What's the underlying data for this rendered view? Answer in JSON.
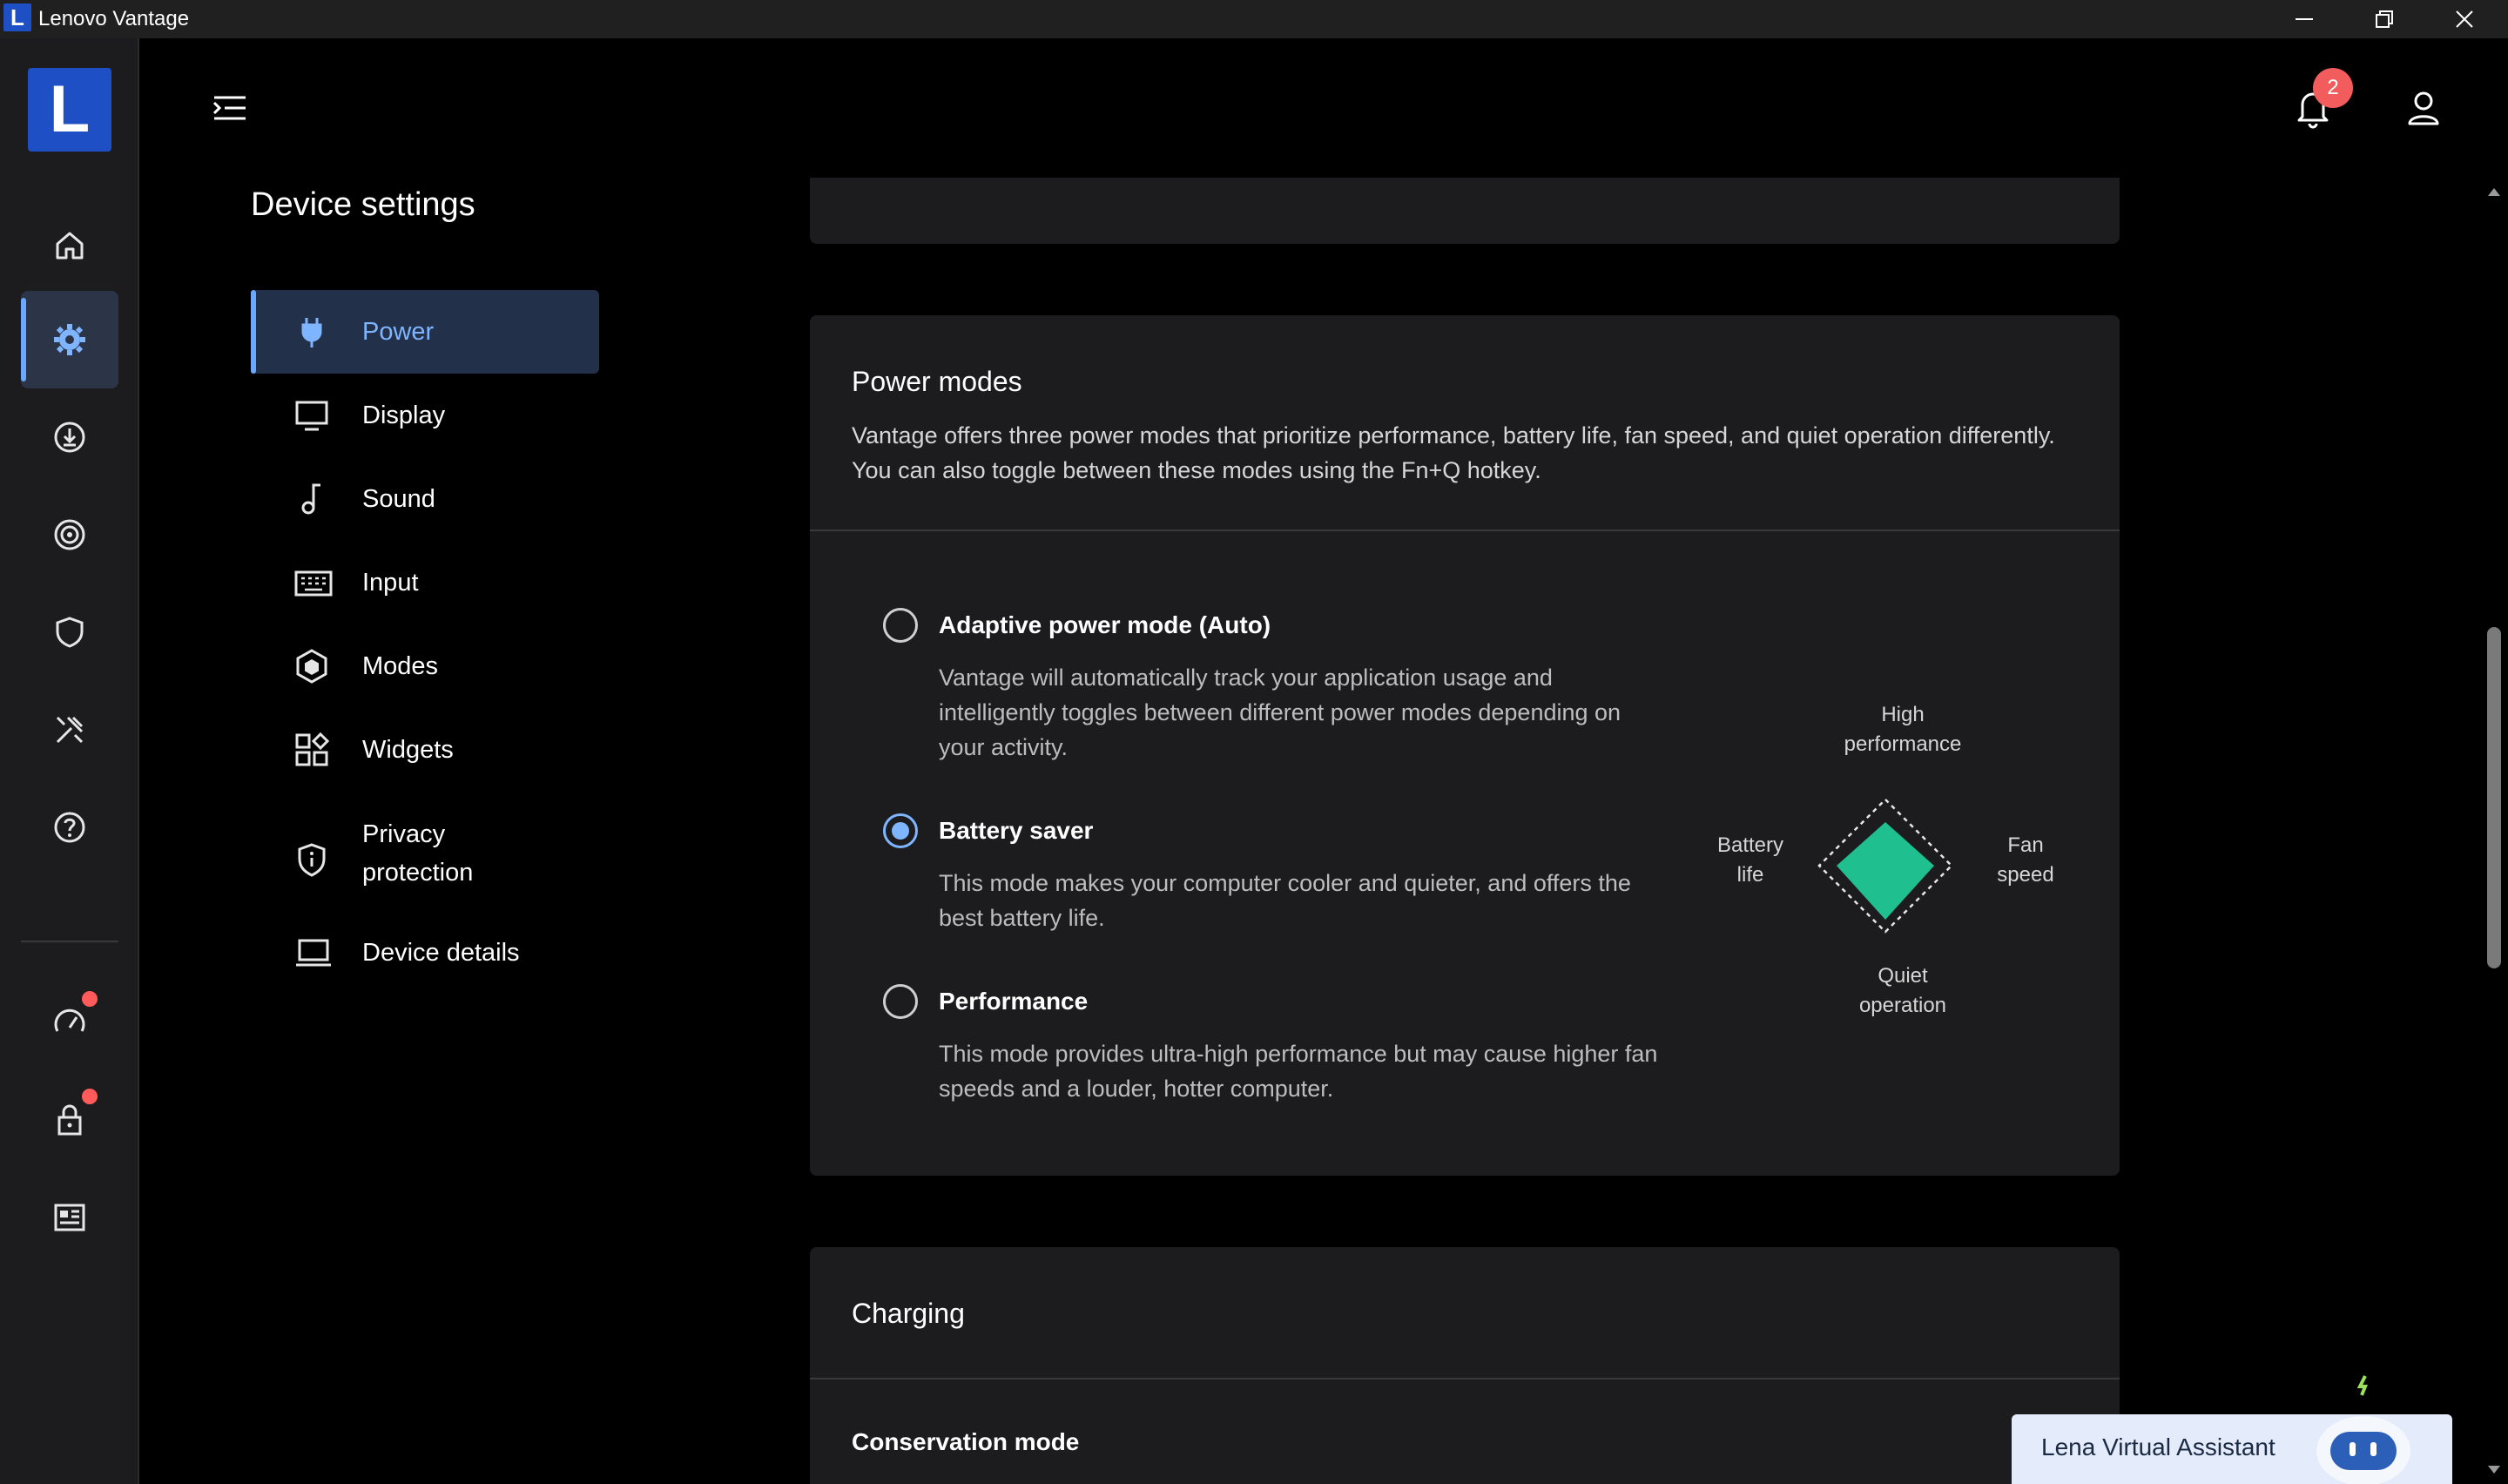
{
  "window": {
    "badge": "L",
    "title": "Lenovo Vantage"
  },
  "rail": {
    "logo": "L",
    "items": [
      {
        "icon": "home-icon"
      },
      {
        "icon": "gear-icon",
        "active": true
      },
      {
        "icon": "download-icon"
      },
      {
        "icon": "target-icon"
      },
      {
        "icon": "shield-icon"
      },
      {
        "icon": "tools-icon"
      },
      {
        "icon": "help-icon"
      },
      {
        "icon": "speedometer-icon",
        "dot": true
      },
      {
        "icon": "lock-icon",
        "dot": true
      },
      {
        "icon": "news-icon"
      }
    ]
  },
  "header": {
    "notifications_count": "2"
  },
  "settings": {
    "title": "Device settings",
    "nav": [
      {
        "label": "Power",
        "icon": "plug-icon",
        "active": true
      },
      {
        "label": "Display",
        "icon": "monitor-icon"
      },
      {
        "label": "Sound",
        "icon": "music-note-icon"
      },
      {
        "label": "Input",
        "icon": "keyboard-icon"
      },
      {
        "label": "Modes",
        "icon": "hexagon-icon"
      },
      {
        "label": "Widgets",
        "icon": "widgets-icon"
      },
      {
        "label": "Privacy protection",
        "line1": "Privacy",
        "line2": "protection",
        "icon": "privacy-shield-icon"
      },
      {
        "label": "Device details",
        "icon": "laptop-icon"
      }
    ]
  },
  "power_modes": {
    "title": "Power modes",
    "description": "Vantage offers three power modes that prioritize performance, battery life, fan speed, and quiet operation differently. You can also toggle between these modes using the Fn+Q hotkey.",
    "selected": "Battery saver",
    "options": [
      {
        "title": "Adaptive power mode (Auto)",
        "description": "Vantage will automatically track your application usage and intelligently toggles between different power modes depending on your activity.",
        "checked": false
      },
      {
        "title": "Battery saver",
        "description": "This mode makes your computer cooler and quieter, and offers the best battery life.",
        "checked": true
      },
      {
        "title": "Performance",
        "description": "This mode provides ultra-high performance but may cause higher fan speeds and a louder, hotter computer.",
        "checked": false
      }
    ],
    "diagram": {
      "top_line1": "High",
      "top_line2": "performance",
      "left_line1": "Battery",
      "left_line2": "life",
      "right_line1": "Fan",
      "right_line2": "speed",
      "bottom_line1": "Quiet",
      "bottom_line2": "operation",
      "fill_color": "#1fbf8f"
    }
  },
  "charging": {
    "title": "Charging",
    "conservation_mode": "Conservation mode"
  },
  "assistant": {
    "label": "Lena Virtual Assistant"
  },
  "colors": {
    "accent": "#7fb4ff",
    "brand": "#1e4fc4",
    "badge": "#f25c5c"
  }
}
